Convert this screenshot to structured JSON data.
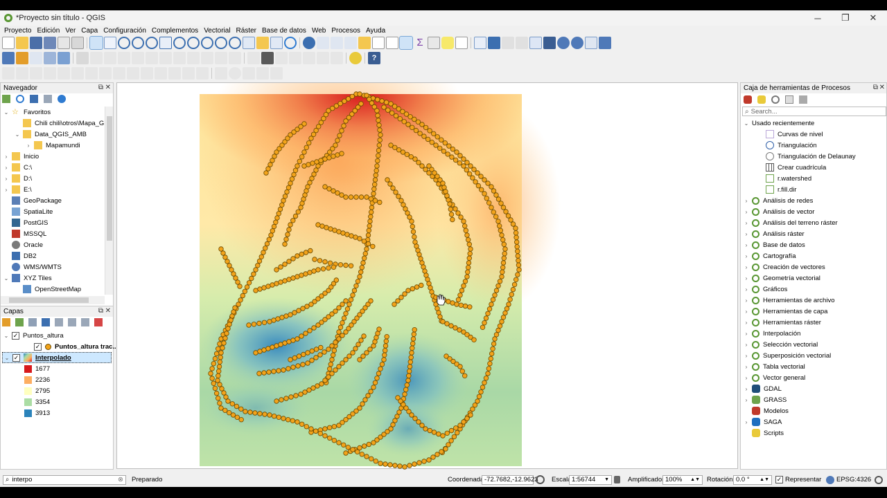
{
  "window": {
    "title": "*Proyecto sin título - QGIS",
    "min": "─",
    "max": "❐",
    "close": "✕"
  },
  "menu": [
    "Proyecto",
    "Edición",
    "Ver",
    "Capa",
    "Configuración",
    "Complementos",
    "Vectorial",
    "Ráster",
    "Base de datos",
    "Web",
    "Procesos",
    "Ayuda"
  ],
  "navegador": {
    "title": "Navegador",
    "items": [
      {
        "label": "Favoritos",
        "icon": "star-icon",
        "expanded": true,
        "indent": 0
      },
      {
        "label": "Chili chili\\otros\\Mapa_GIS",
        "icon": "folder-icon",
        "indent": 1
      },
      {
        "label": "Data_QGIS_AMB",
        "icon": "folder-icon",
        "expanded": true,
        "indent": 1
      },
      {
        "label": "Mapamundi",
        "icon": "folder-icon",
        "collapsed": true,
        "indent": 2
      },
      {
        "label": "Inicio",
        "icon": "folder-icon",
        "collapsed": true,
        "indent": 0
      },
      {
        "label": "C:\\",
        "icon": "folder-icon",
        "collapsed": true,
        "indent": 0
      },
      {
        "label": "D:\\",
        "icon": "folder-icon",
        "collapsed": true,
        "indent": 0
      },
      {
        "label": "E:\\",
        "icon": "folder-icon",
        "collapsed": true,
        "indent": 0
      },
      {
        "label": "GeoPackage",
        "icon": "geopackage-icon",
        "indent": 0
      },
      {
        "label": "SpatiaLite",
        "icon": "spatialite-icon",
        "indent": 0
      },
      {
        "label": "PostGIS",
        "icon": "postgis-icon",
        "indent": 0
      },
      {
        "label": "MSSQL",
        "icon": "mssql-icon",
        "indent": 0
      },
      {
        "label": "Oracle",
        "icon": "oracle-icon",
        "indent": 0
      },
      {
        "label": "DB2",
        "icon": "db2-icon",
        "indent": 0
      },
      {
        "label": "WMS/WMTS",
        "icon": "globe-icon",
        "indent": 0
      },
      {
        "label": "XYZ Tiles",
        "icon": "xyz-icon",
        "expanded": true,
        "indent": 0
      },
      {
        "label": "OpenStreetMap",
        "icon": "map-tile-icon",
        "indent": 1
      }
    ]
  },
  "capas": {
    "title": "Capas",
    "layers": [
      {
        "label": "Puntos_altura",
        "checked": true,
        "group": true
      },
      {
        "label": "Puntos_altura trac...",
        "checked": true
      },
      {
        "label": "Interpolado",
        "checked": true,
        "selected": true
      }
    ],
    "legend": [
      {
        "label": "1677",
        "color": "#d7191c"
      },
      {
        "label": "2236",
        "color": "#fdae61"
      },
      {
        "label": "2795",
        "color": "#ffffbf"
      },
      {
        "label": "3354",
        "color": "#abdda4"
      },
      {
        "label": "3913",
        "color": "#2b83ba"
      }
    ]
  },
  "procesos": {
    "title": "Caja de herramientas de Procesos",
    "search_placeholder": "Search...",
    "recent_group": "Usado recientemente",
    "recent": [
      "Curvas de nivel",
      "Triangulación",
      "Triangulación de Delaunay",
      "Crear cuadrícula",
      "r.watershed",
      "r.fill.dir"
    ],
    "groups": [
      "Análisis de redes",
      "Análisis de vector",
      "Análisis del terreno ráster",
      "Análisis ráster",
      "Base de datos",
      "Cartografía",
      "Creación de vectores",
      "Geometría vectorial",
      "Gráficos",
      "Herramientas de archivo",
      "Herramientas de capa",
      "Herramientas ráster",
      "Interpolación",
      "Selección vectorial",
      "Superposición vectorial",
      "Tabla vectorial",
      "Vector general"
    ],
    "providers": [
      "GDAL",
      "GRASS",
      "Modelos",
      "SAGA",
      "Scripts"
    ]
  },
  "status": {
    "locator": "interpo",
    "message": "Preparado",
    "coord_label": "Coordenada",
    "coord_value": "-72.7682,-12.9623",
    "scale_label": "Escala",
    "scale_value": "1:56744",
    "magnifier_label": "Amplificador",
    "magnifier_value": "100%",
    "rotation_label": "Rotación",
    "rotation_value": "0.0 °",
    "render_label": "Representar",
    "crs": "EPSG:4326"
  },
  "colors": {
    "accent_select": "#cde8ff",
    "qgis_green": "#589632",
    "point_fill": "#f2a31b",
    "point_stroke": "#6b4a00"
  }
}
